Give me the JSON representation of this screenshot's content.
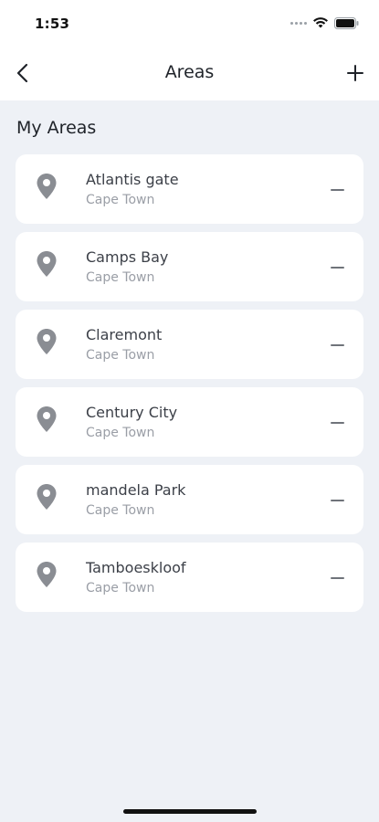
{
  "status_bar": {
    "time": "1:53",
    "icons": [
      "signal-dots-icon",
      "wifi-icon",
      "battery-icon"
    ]
  },
  "nav": {
    "title": "Areas",
    "back_icon": "chevron-left-icon",
    "add_icon": "plus-icon"
  },
  "section": {
    "title": "My Areas"
  },
  "areas": [
    {
      "name": "Atlantis gate",
      "city": "Cape Town"
    },
    {
      "name": "Camps Bay",
      "city": "Cape Town"
    },
    {
      "name": "Claremont",
      "city": "Cape Town"
    },
    {
      "name": "Century City",
      "city": "Cape Town"
    },
    {
      "name": "mandela Park",
      "city": "Cape Town"
    },
    {
      "name": "Tamboeskloof",
      "city": "Cape Town"
    }
  ],
  "colors": {
    "background": "#eef1f6",
    "card": "#ffffff",
    "pin": "#8a8d93",
    "title": "#1f2329",
    "subtitle": "#9a9ea6"
  }
}
